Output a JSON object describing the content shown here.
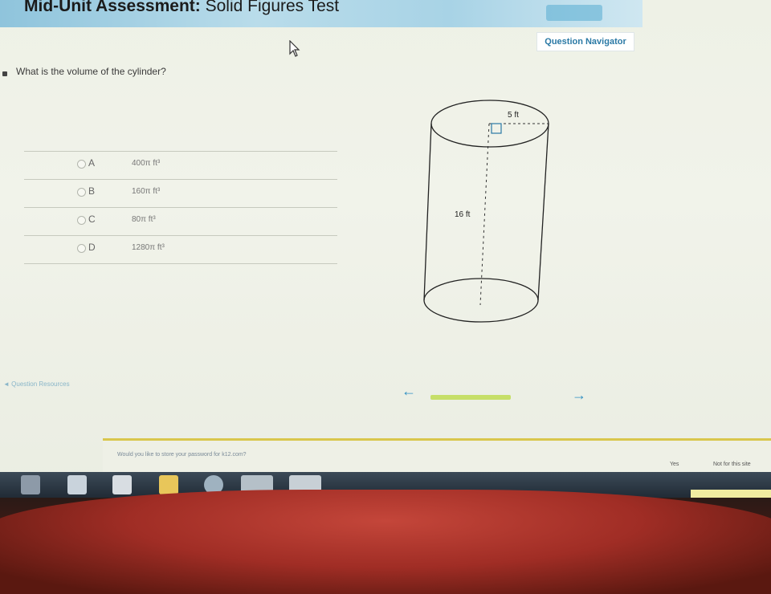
{
  "header": {
    "title_bold": "Mid-Unit Assessment:",
    "title_rest": "Solid Figures Test"
  },
  "question_navigator": "Question Navigator",
  "question": {
    "text": "What is the volume of the cylinder?"
  },
  "choices": [
    {
      "letter": "A",
      "value": "400π ft³"
    },
    {
      "letter": "B",
      "value": "160π ft³"
    },
    {
      "letter": "C",
      "value": "80π ft³"
    },
    {
      "letter": "D",
      "value": "1280π ft³"
    }
  ],
  "figure": {
    "radius_label": "5 ft",
    "height_label": "16 ft"
  },
  "navigation": {
    "review_link": "◄ Question Resources",
    "prev_icon": "←",
    "next_icon": "→"
  },
  "notification": {
    "text": "Would you like to store your password for k12.com?",
    "yes": "Yes",
    "no": "Not for this site"
  },
  "colors": {
    "header": "#a8d3e6",
    "accent": "#2a79a5",
    "progress": "#c6df68"
  }
}
